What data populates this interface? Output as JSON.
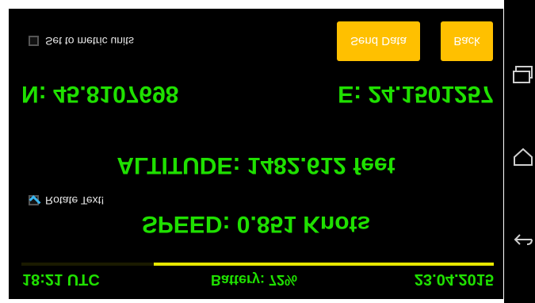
{
  "header": {
    "metric_label": "Set to metric units",
    "send_label": "Send Data",
    "back_label": "Back"
  },
  "coords": {
    "north": "N: 45.8107698",
    "east": "E: 24.1501257"
  },
  "readings": {
    "altitude": "ALTITUDE: 1482.612 feet",
    "speed": "SPEED: 0.851 Knots"
  },
  "rotate_label": "Rotate Text!",
  "status": {
    "time": "18:21 UTC",
    "battery": "Battery: 72%",
    "date": "23.04.2015",
    "battery_level": 0.72
  },
  "colors": {
    "text": "#1fe000",
    "button": "#ffc000",
    "battery_bar": "#e7e700"
  },
  "nav_icons": [
    "recent-apps-icon",
    "home-icon",
    "back-icon"
  ]
}
